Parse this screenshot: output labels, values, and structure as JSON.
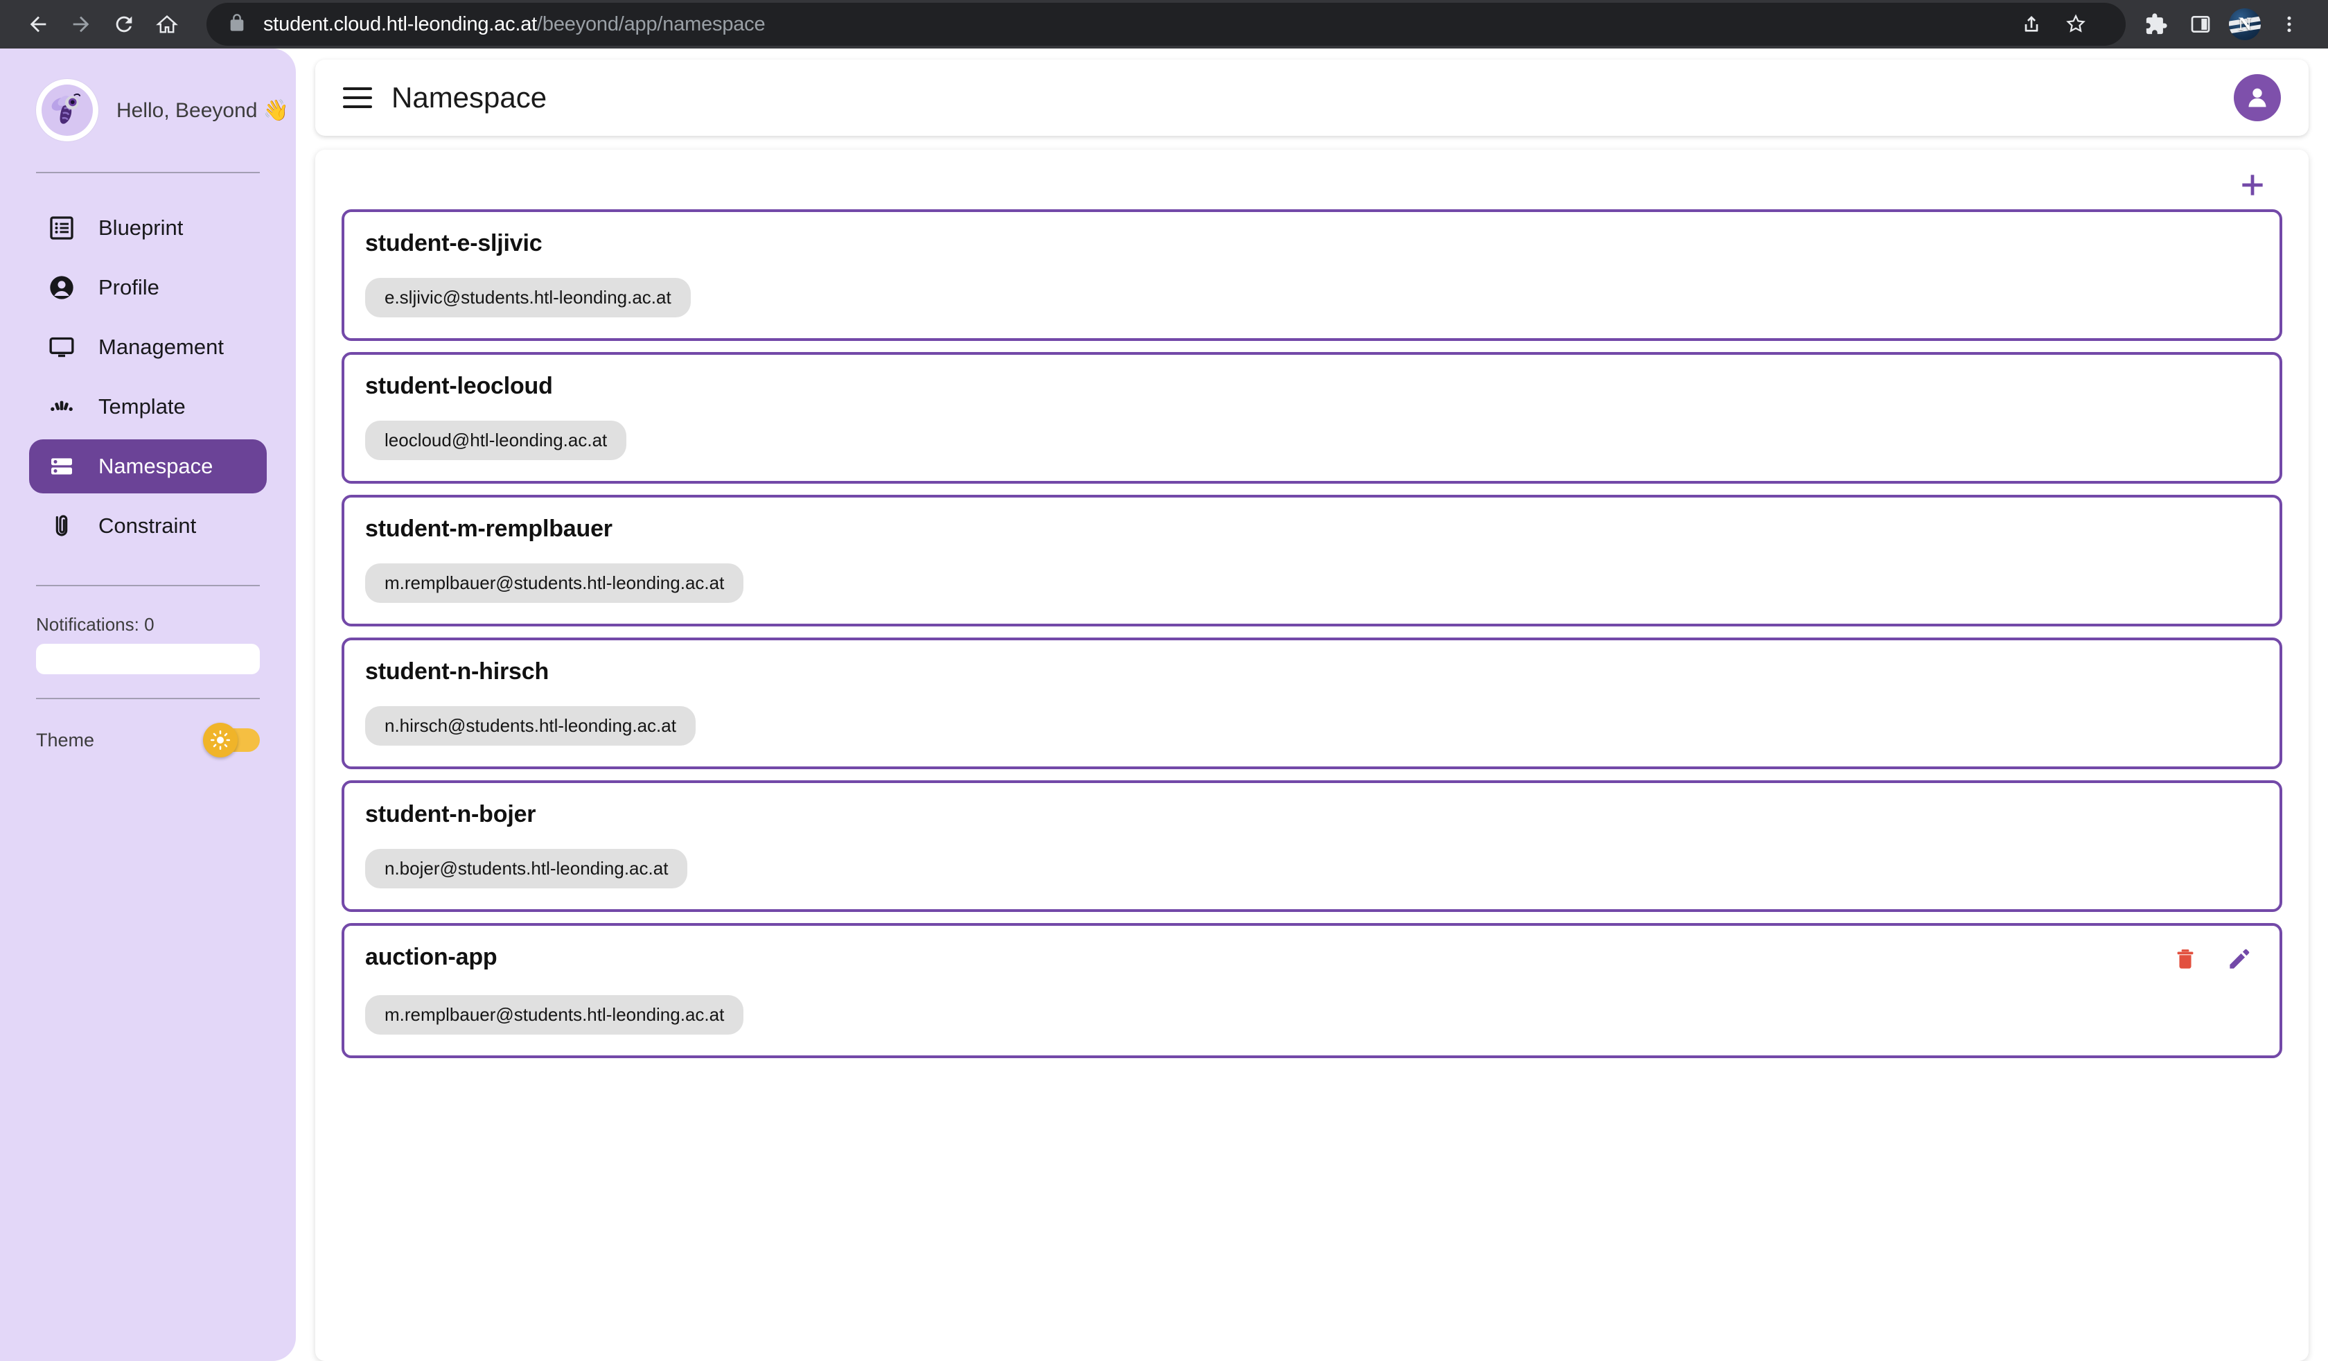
{
  "browser": {
    "back_icon": "back-arrow-icon",
    "forward_icon": "forward-arrow-icon",
    "reload_icon": "reload-icon",
    "home_icon": "home-icon",
    "lock_icon": "lock-icon",
    "url_domain": "student.cloud.htl-leonding.ac.at",
    "url_path": "/beeyond/app/namespace",
    "share_icon": "share-icon",
    "bookmark_icon": "star-icon",
    "extensions_icon": "puzzle-piece-icon",
    "sidepanel_icon": "side-panel-icon",
    "profile_initial": "N",
    "menu_icon": "three-dot-menu-icon"
  },
  "sidebar": {
    "avatar_icon": "bee-avatar-icon",
    "greeting": "Hello, Beeyond 👋",
    "items": [
      {
        "label": "Blueprint",
        "icon": "list-alt-icon",
        "active": false
      },
      {
        "label": "Profile",
        "icon": "account-circle-icon",
        "active": false
      },
      {
        "label": "Management",
        "icon": "desktop-monitor-icon",
        "active": false
      },
      {
        "label": "Template",
        "icon": "widgets-fan-icon",
        "active": false
      },
      {
        "label": "Namespace",
        "icon": "storage-rows-icon",
        "active": true
      },
      {
        "label": "Constraint",
        "icon": "paperclip-icon",
        "active": false
      }
    ],
    "notifications_label": "Notifications: 0",
    "notifications_value": "",
    "theme_label": "Theme",
    "theme_toggle_state": "on",
    "theme_toggle_icon": "sun-icon",
    "theme_toggle_color": "#f0b429"
  },
  "topbar": {
    "menu_icon": "hamburger-menu-icon",
    "title": "Namespace",
    "account_icon": "person-icon",
    "account_color": "#7e50ab"
  },
  "main": {
    "add_icon": "plus-icon",
    "add_color": "#7349a8",
    "card_border_color": "#7349a8",
    "delete_icon_color": "#e2503f",
    "edit_icon_color": "#7349a8",
    "namespaces": [
      {
        "name": "student-e-sljivic",
        "email": "e.sljivic@students.htl-leonding.ac.at",
        "has_actions": false
      },
      {
        "name": "student-leocloud",
        "email": "leocloud@htl-leonding.ac.at",
        "has_actions": false
      },
      {
        "name": "student-m-remplbauer",
        "email": "m.remplbauer@students.htl-leonding.ac.at",
        "has_actions": false
      },
      {
        "name": "student-n-hirsch",
        "email": "n.hirsch@students.htl-leonding.ac.at",
        "has_actions": false
      },
      {
        "name": "student-n-bojer",
        "email": "n.bojer@students.htl-leonding.ac.at",
        "has_actions": false
      },
      {
        "name": "auction-app",
        "email": "m.remplbauer@students.htl-leonding.ac.at",
        "has_actions": true,
        "delete_icon": "trash-icon",
        "edit_icon": "pencil-icon"
      }
    ]
  }
}
